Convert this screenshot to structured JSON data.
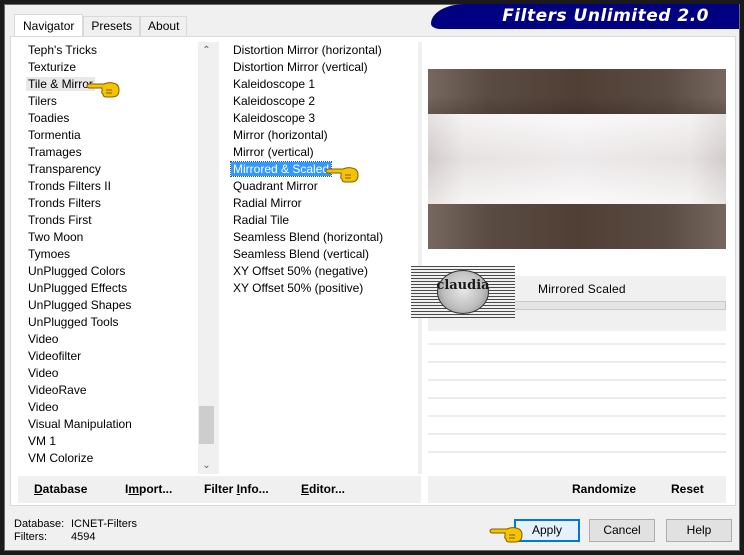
{
  "window": {
    "title": "Filters Unlimited 2.0"
  },
  "tabs": [
    {
      "label": "Navigator",
      "active": true
    },
    {
      "label": "Presets",
      "active": false
    },
    {
      "label": "About",
      "active": false
    }
  ],
  "categories": {
    "items": [
      "Teph's Tricks",
      "Texturize",
      "Tile & Mirror",
      "Tilers",
      "Toadies",
      "Tormentia",
      "Tramages",
      "Transparency",
      "Tronds Filters II",
      "Tronds Filters",
      "Tronds First",
      "Two Moon",
      "Tymoes",
      "UnPlugged Colors",
      "UnPlugged Effects",
      "UnPlugged Shapes",
      "UnPlugged Tools",
      "Video",
      "Videofilter",
      "Video",
      "VideoRave",
      "Video",
      "Visual Manipulation",
      "VM 1",
      "VM Colorize"
    ],
    "current": "Tile & Mirror",
    "scroll_icons": {
      "up": "chevron-up-icon",
      "down": "chevron-down-icon"
    }
  },
  "filters": {
    "items": [
      "Distortion Mirror (horizontal)",
      "Distortion Mirror (vertical)",
      "Kaleidoscope 1",
      "Kaleidoscope 2",
      "Kaleidoscope 3",
      "Mirror (horizontal)",
      "Mirror (vertical)",
      "Mirrored & Scaled",
      "Quadrant Mirror",
      "Radial Mirror",
      "Radial Tile",
      "Seamless Blend (horizontal)",
      "Seamless Blend (vertical)",
      "XY Offset 50% (negative)",
      "XY Offset 50% (positive)"
    ],
    "selected": "Mirrored & Scaled"
  },
  "parameters": {
    "title": "Mirrored  Scaled"
  },
  "watermark": {
    "text": "claudia"
  },
  "toolbar_left": {
    "database": {
      "pre": "",
      "u": "D",
      "post": "atabase"
    },
    "import": {
      "pre": "I",
      "u": "m",
      "post": "port..."
    },
    "filter_info": {
      "pre": "Filter ",
      "u": "I",
      "post": "nfo..."
    },
    "editor": {
      "pre": "",
      "u": "E",
      "post": "ditor..."
    }
  },
  "toolbar_right": {
    "randomize": "Randomize",
    "reset": "Reset"
  },
  "status": {
    "database_label": "Database:",
    "database_value": "ICNET-Filters",
    "filters_label": "Filters:",
    "filters_value": "4594"
  },
  "buttons": {
    "apply": "Apply",
    "cancel": "Cancel",
    "help": "Help"
  },
  "colors": {
    "banner": "#000080",
    "selection": "#3399ff",
    "default_button_border": "#0078d7",
    "hand": "#f5c400"
  }
}
